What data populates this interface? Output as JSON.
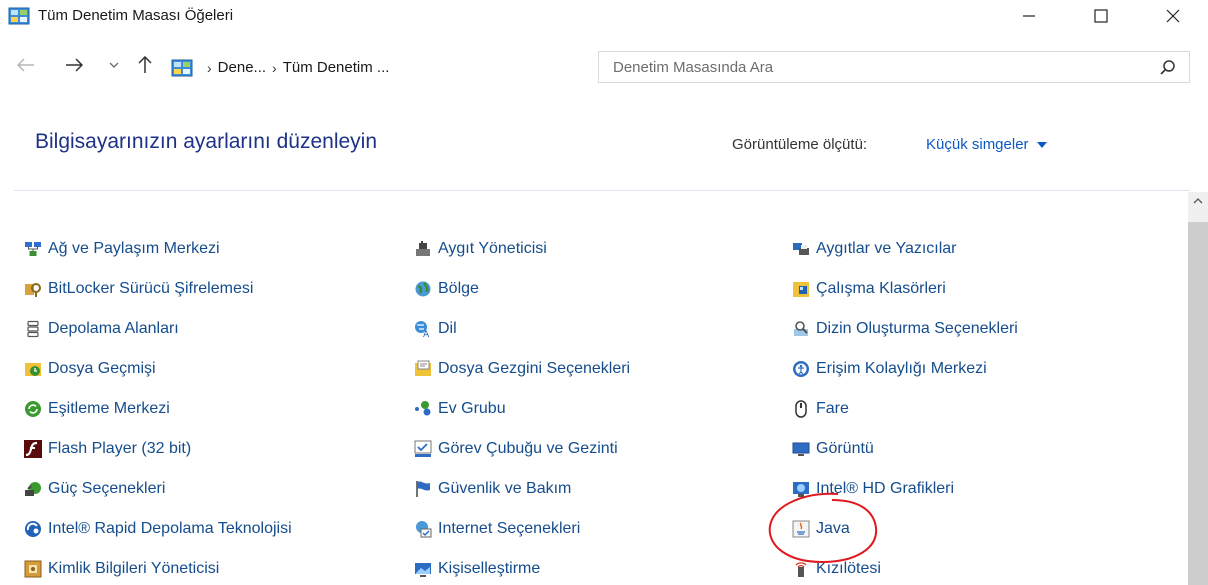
{
  "window": {
    "title": "Tüm Denetim Masası Öğeleri",
    "controls": {
      "minimize": "minimize",
      "maximize": "maximize",
      "close": "close"
    }
  },
  "navigation": {
    "breadcrumb": [
      "Dene...",
      "Tüm Denetim ..."
    ],
    "search_placeholder": "Denetim Masasında Ara"
  },
  "header": {
    "title": "Bilgisayarınızın ayarlarını düzenleyin",
    "view_by_label": "Görüntüleme ölçütü:",
    "view_by_value": "Küçük simgeler"
  },
  "items": [
    [
      "Ağ ve Paylaşım Merkezi",
      "Aygıt Yöneticisi",
      "Aygıtlar ve Yazıcılar"
    ],
    [
      "BitLocker Sürücü Şifrelemesi",
      "Bölge",
      "Çalışma Klasörleri"
    ],
    [
      "Depolama Alanları",
      "Dil",
      "Dizin Oluşturma Seçenekleri"
    ],
    [
      "Dosya Geçmişi",
      "Dosya Gezgini Seçenekleri",
      "Erişim Kolaylığı Merkezi"
    ],
    [
      "Eşitleme Merkezi",
      "Ev Grubu",
      "Fare"
    ],
    [
      "Flash Player (32 bit)",
      "Görev Çubuğu ve Gezinti",
      "Görüntü"
    ],
    [
      "Güç Seçenekleri",
      "Güvenlik ve Bakım",
      "Intel® HD Grafikleri"
    ],
    [
      "Intel® Rapid Depolama Teknolojisi",
      "Internet Seçenekleri",
      "Java"
    ],
    [
      "Kimlik Bilgileri Yöneticisi",
      "Kişiselleştirme",
      "Kızılötesi"
    ]
  ],
  "colors": {
    "link": "#154d8c",
    "heading": "#1e3287",
    "accent": "#0c58c4",
    "annotation": "#e0191f"
  }
}
